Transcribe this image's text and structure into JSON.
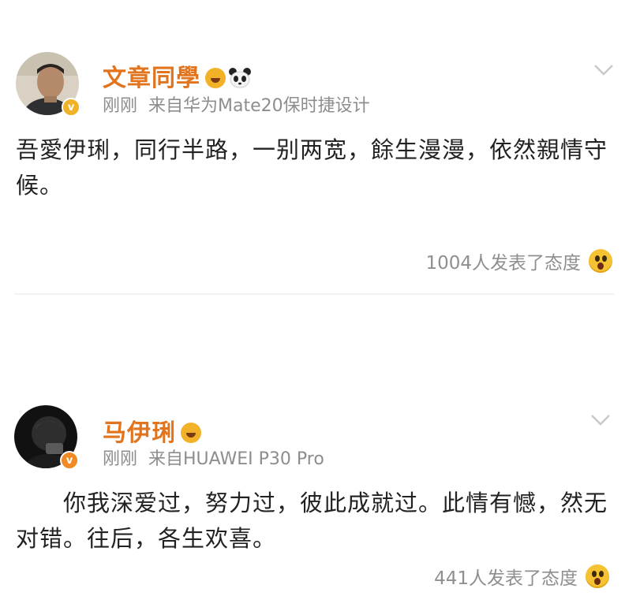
{
  "posts": [
    {
      "username": "文章同學",
      "time": "刚刚",
      "source": "来自华为Mate20保时捷设计",
      "text": "吾愛伊琍，同行半路，一别两宽，餘生漫漫，依然親情守候。",
      "reactions": "1004人发表了态度",
      "badge_color": "#f2b227"
    },
    {
      "username": "马伊琍",
      "time": "刚刚",
      "source": "来自HUAWEI P30 Pro",
      "text": "你我深爱过，努力过，彼此成就过。此情有憾，然无对错。往后，各生欢喜。",
      "reactions": "441人发表了态度",
      "badge_color": "#f08a24"
    }
  ],
  "colors": {
    "username": "#e2741d",
    "meta": "#8d8d8d",
    "accent": "#f2b227"
  },
  "icons": [
    "verified-badge-icon",
    "crown-emoji-icon",
    "panda-emoji-icon",
    "chevron-down-icon",
    "surprised-emoji-icon"
  ]
}
